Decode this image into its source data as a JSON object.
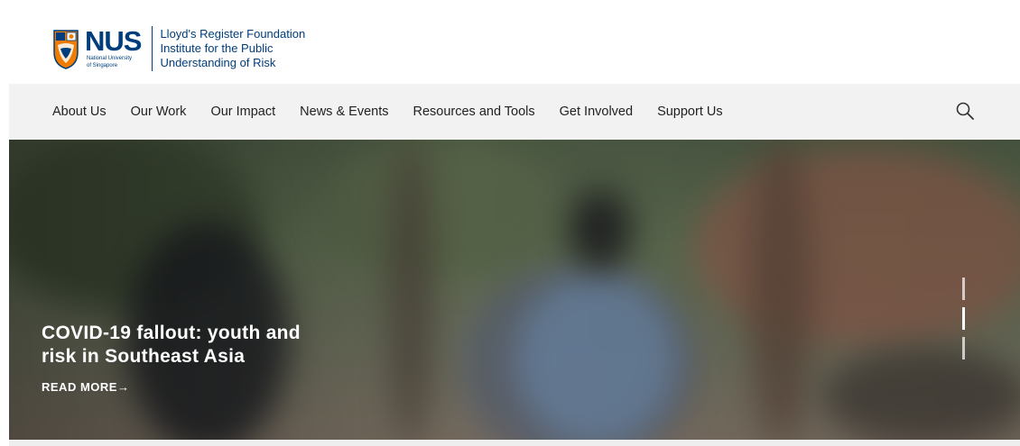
{
  "brand": {
    "logo_word": "NUS",
    "logo_sub_line1": "National University",
    "logo_sub_line2": "of Singapore",
    "institute_line1": "Lloyd's Register Foundation",
    "institute_line2": "Institute for the Public",
    "institute_line3": "Understanding of Risk"
  },
  "nav": {
    "items": [
      {
        "label": "About Us"
      },
      {
        "label": "Our Work"
      },
      {
        "label": "Our Impact"
      },
      {
        "label": "News & Events"
      },
      {
        "label": "Resources and Tools"
      },
      {
        "label": "Get Involved"
      },
      {
        "label": "Support Us"
      }
    ],
    "search_icon": "search-icon"
  },
  "hero": {
    "title_line1": "COVID-19 fallout: youth and",
    "title_line2": "risk in Southeast Asia",
    "cta_label": "READ MORE",
    "cta_arrow": "→",
    "slides_total": 3,
    "active_slide": 2
  },
  "colors": {
    "brand_blue": "#003D7C",
    "brand_orange": "#EF7C00",
    "nav_bg": "#f2f2f2"
  }
}
